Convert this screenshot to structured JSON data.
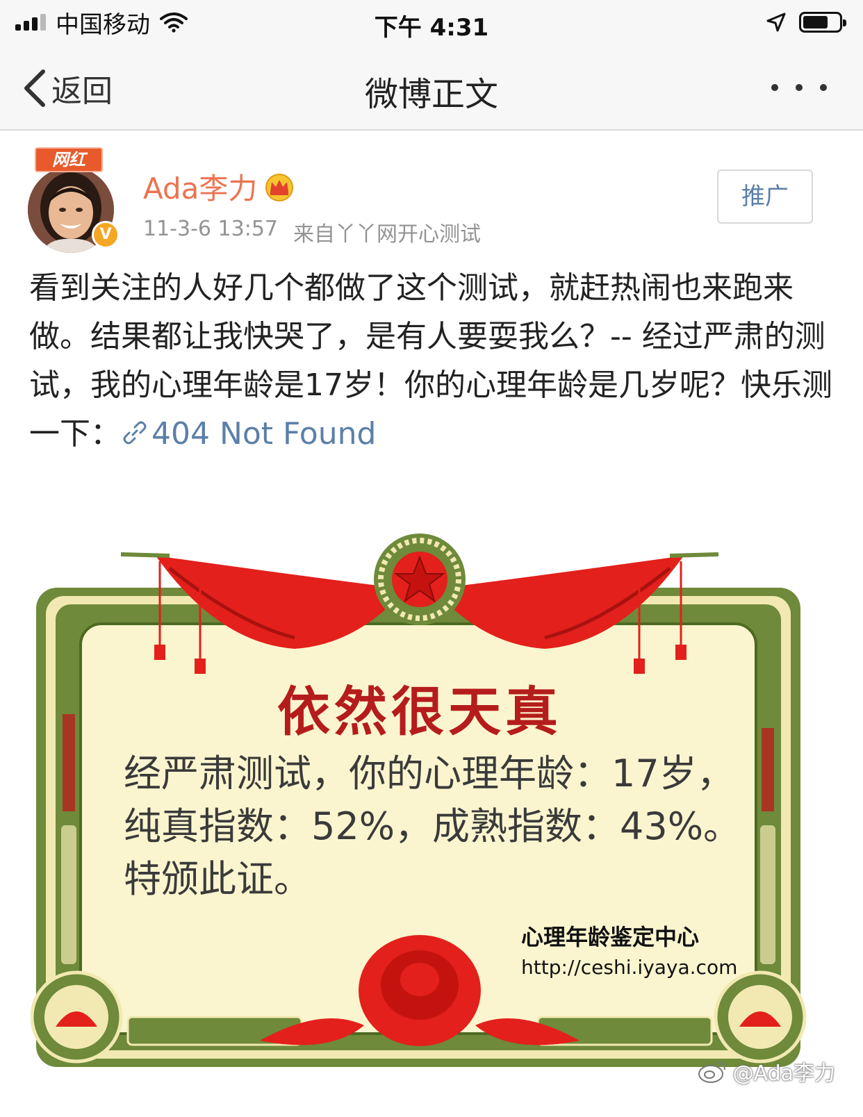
{
  "status_bar": {
    "carrier": "中国移动",
    "time": "下午 4:31",
    "battery_level": 0.7
  },
  "nav": {
    "back_label": "返回",
    "title": "微博正文"
  },
  "post": {
    "badge": "网红",
    "verified_mark": "V",
    "username": "Ada李力",
    "timestamp": "11-3-6 13:57",
    "source": "来自丫丫网开心测试",
    "promote_label": "推广",
    "text": "看到关注的人好几个都做了这个测试，就赶热闹也来跑来做。结果都让我快哭了，是有人要耍我么？-- 经过严肃的测试，我的心理年龄是17岁！你的心理年龄是几岁呢？快乐测一下：",
    "link_text": "404 Not Found"
  },
  "certificate": {
    "title": "依然很天真",
    "line1": "经严肃测试，你的心理年龄：17岁，",
    "line2": "纯真指数：52%，成熟指数：43%。",
    "line3": "特颁此证。",
    "issuer": "心理年龄鉴定中心",
    "url": "http://ceshi.iyaya.com"
  },
  "watermark": "@Ada李力",
  "colors": {
    "username": "#eb7350",
    "link": "#5b7fa8",
    "cert_title": "#b51c1c",
    "cert_frame": "#6e8a3a",
    "cert_paper": "#fbf5cf",
    "cert_red": "#e3201b"
  },
  "icons": {
    "back": "chevron-left-icon",
    "more": "more-dots-icon",
    "vip": "crown-icon",
    "link": "link-icon",
    "watermark": "weibo-logo-icon"
  }
}
